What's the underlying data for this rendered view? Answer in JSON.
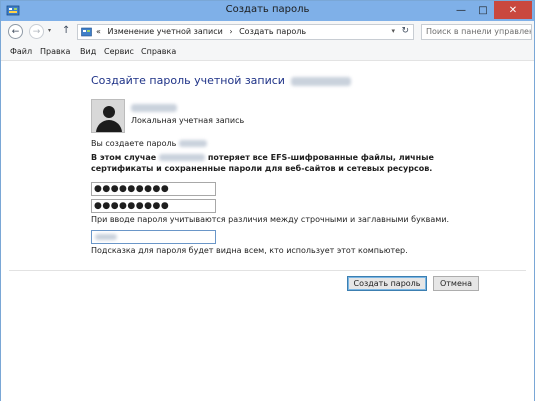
{
  "window": {
    "title": "Создать пароль",
    "controls": {
      "minimize": "—",
      "maximize": "□",
      "close": "✕"
    }
  },
  "address_bar": {
    "crumb_prefix": "«",
    "crumbs": [
      "Изменение учетной записи",
      "Создать пароль"
    ],
    "separator": "›",
    "search_placeholder": "Поиск в панели управления"
  },
  "menu": {
    "items": [
      "Файл",
      "Правка",
      "Вид",
      "Сервис",
      "Справка"
    ]
  },
  "content": {
    "heading": "Создайте пароль учетной записи",
    "account_type": "Локальная учетная запись",
    "creating_for": "Вы создаете пароль",
    "warning_prefix": "В этом случае",
    "warning_text": "потеряет все EFS-шифрованные файлы, личные сертификаты и сохраненные пароли для веб-сайтов и сетевых ресурсов.",
    "password": "●●●●●●●●●",
    "password_confirm": "●●●●●●●●●",
    "case_note": "При вводе пароля учитываются различия между строчными и заглавными буквами.",
    "hint_note": "Подсказка для пароля будет видна всем, кто использует этот компьютер."
  },
  "buttons": {
    "create": "Создать пароль",
    "cancel": "Отмена"
  },
  "colors": {
    "titlebar": "#7fb0e8",
    "heading": "#1e3287",
    "close": "#c9483e"
  }
}
